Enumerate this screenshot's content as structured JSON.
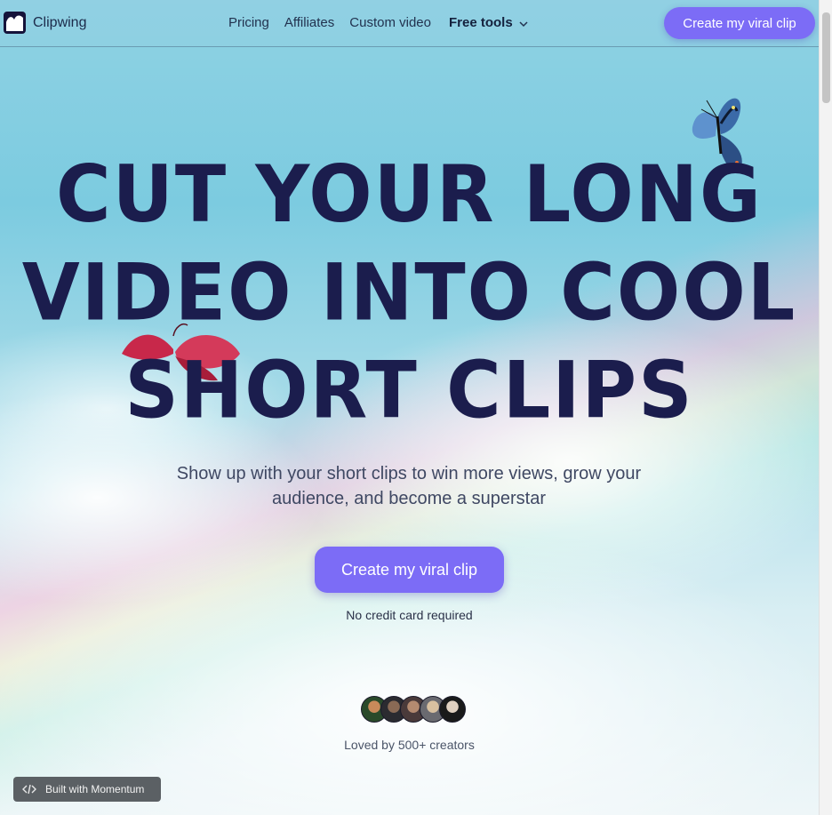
{
  "navbar": {
    "brand": "Clipwing",
    "links": [
      "Pricing",
      "Affiliates",
      "Custom video"
    ],
    "free_tools": "Free tools",
    "cta": "Create my viral clip"
  },
  "hero": {
    "headline": [
      "CUT YOUR LONG",
      "VIDEO INTO COOL",
      "SHORT CLIPS"
    ],
    "subtitle": "Show up with your short clips to win more views, grow your audience, and become a superstar",
    "cta": "Create my viral clip",
    "note": "No credit card required"
  },
  "social_proof": {
    "text": "Loved by 500+ creators"
  },
  "badge": {
    "label": "Built with Momentum"
  },
  "colors": {
    "accent": "#7c6cf6",
    "headline": "#1b1d4d"
  },
  "icons": [
    "logo-icon",
    "chevron-down-icon",
    "code-icon",
    "butterfly-image"
  ]
}
